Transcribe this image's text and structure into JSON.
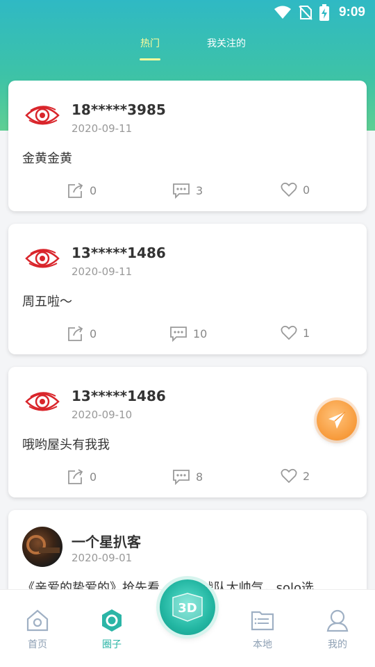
{
  "status_bar": {
    "time": "9:09"
  },
  "tabs": [
    {
      "label": "热门",
      "active": true
    },
    {
      "label": "我关注的",
      "active": false
    }
  ],
  "posts": [
    {
      "username": "18*****3985",
      "date": "2020-09-11",
      "text": "金黄金黄",
      "shares": "0",
      "comments": "3",
      "likes": "0",
      "avatar": "eye-logo"
    },
    {
      "username": "13*****1486",
      "date": "2020-09-11",
      "text": "周五啦～",
      "shares": "0",
      "comments": "10",
      "likes": "1",
      "avatar": "eye-logo"
    },
    {
      "username": "13*****1486",
      "date": "2020-09-10",
      "text": "哦哟屋头有我我",
      "shares": "0",
      "comments": "8",
      "likes": "2",
      "avatar": "eye-logo"
    },
    {
      "username": "一个星扒客",
      "date": "2020-09-01",
      "text": "《亲爱的挚爱的》抢先看，新KK战队太帅气，solo选",
      "avatar": "photo"
    }
  ],
  "bottom_nav": [
    {
      "label": "首页",
      "icon": "home-icon",
      "active": false
    },
    {
      "label": "圈子",
      "icon": "circle-icon",
      "active": true
    },
    {
      "label": "本地",
      "icon": "folder-icon",
      "active": false
    },
    {
      "label": "我的",
      "icon": "user-icon",
      "active": false
    }
  ],
  "center_button": {
    "icon": "3d-icon",
    "text": "3D"
  },
  "colors": {
    "accent": "#2bb5a6",
    "tab_active": "#fffc9c",
    "fab": "#f79a3a"
  }
}
